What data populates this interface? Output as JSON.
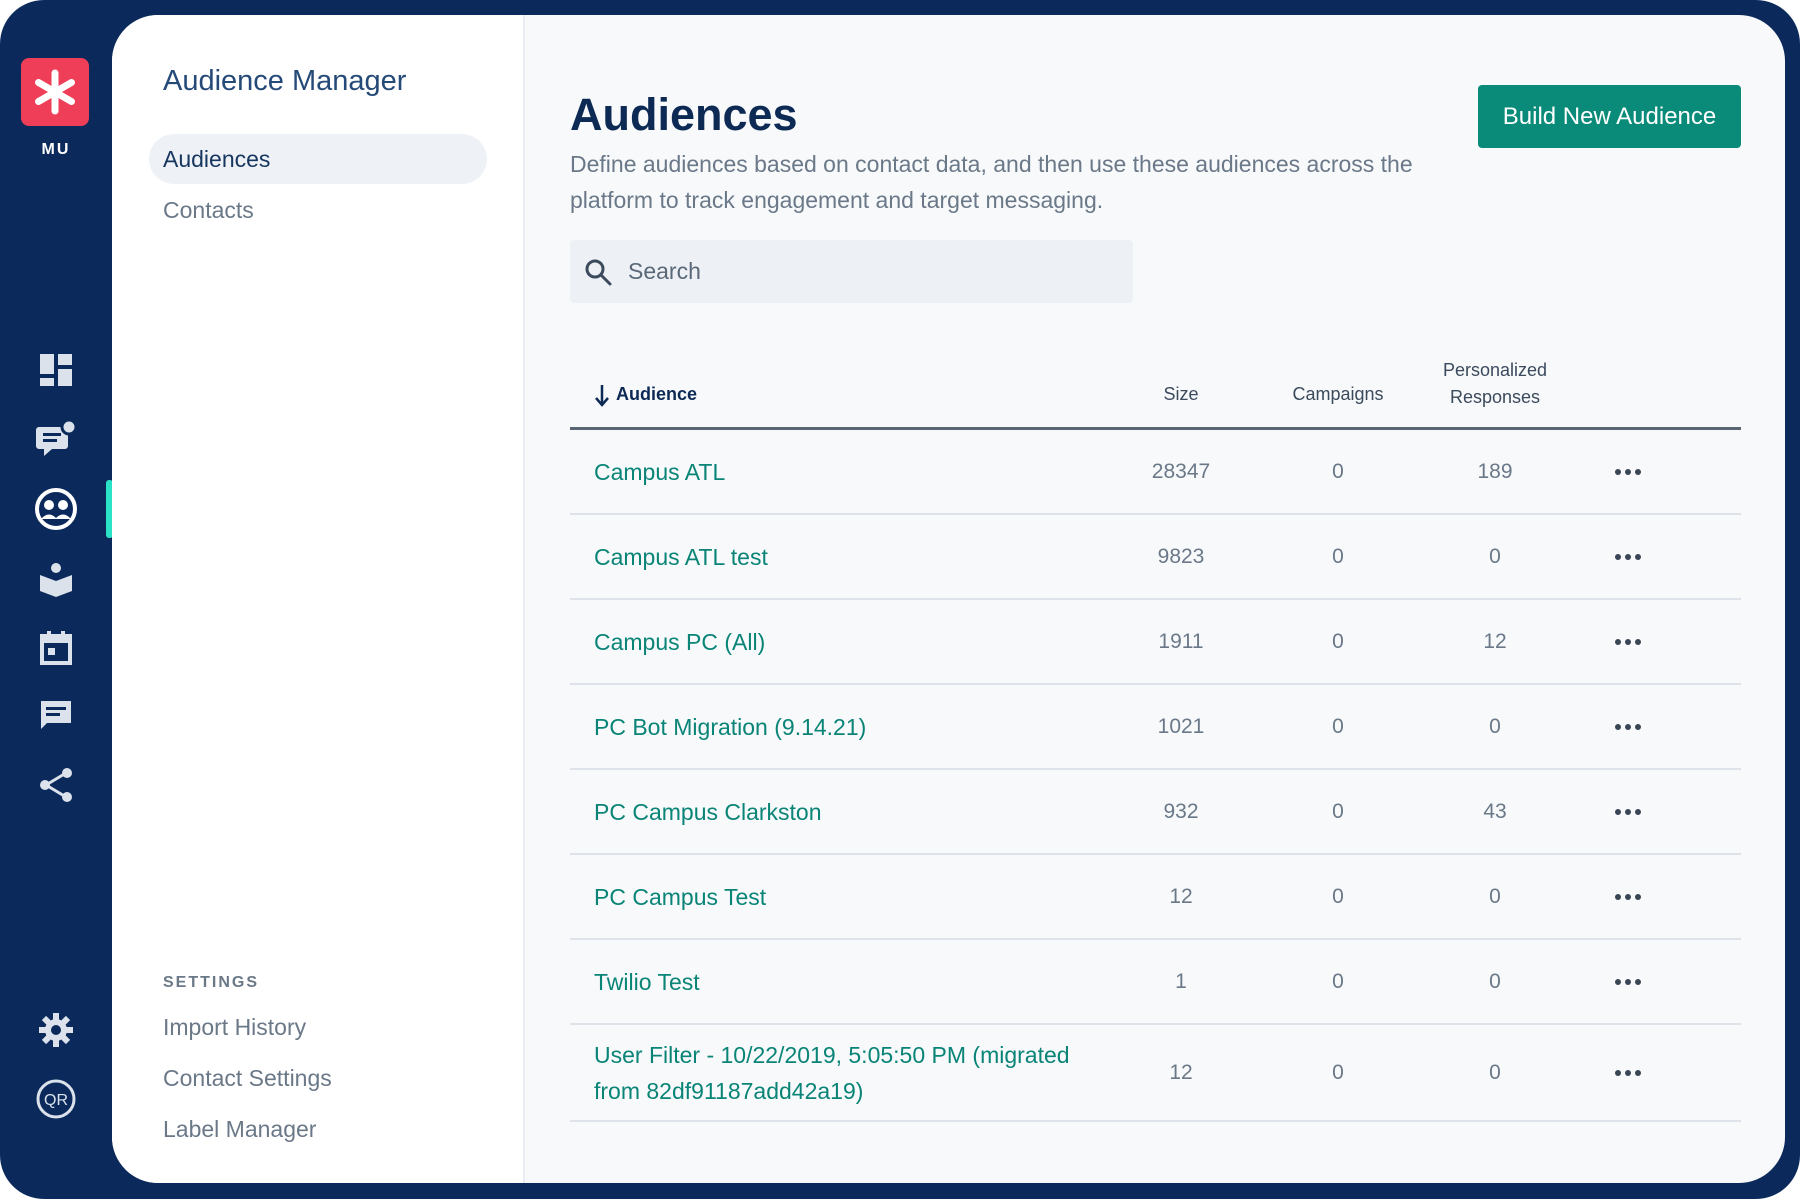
{
  "rail": {
    "logo_text": "MU",
    "accent": "#2ce2c6",
    "icons": [
      "dashboard-icon",
      "chat-bubbles-icon",
      "audience-icon",
      "book-icon",
      "calendar-icon",
      "message-icon",
      "share-icon",
      "gear-icon",
      "qr-icon"
    ]
  },
  "subnav": {
    "title": "Audience Manager",
    "items": [
      {
        "label": "Audiences",
        "active": true
      },
      {
        "label": "Contacts",
        "active": false
      }
    ],
    "settings_heading": "SETTINGS",
    "settings_items": [
      "Import History",
      "Contact Settings",
      "Label Manager"
    ]
  },
  "main": {
    "title": "Audiences",
    "description": "Define audiences based on contact data, and then use these audiences across the platform to track engagement and target messaging.",
    "build_button": "Build New Audience",
    "search_placeholder": "Search",
    "colors": {
      "primary": "#0a8a79",
      "link": "#0a8477",
      "navy": "#0b2a5b"
    }
  },
  "table": {
    "headers": {
      "audience": "Audience",
      "size": "Size",
      "campaigns": "Campaigns",
      "responses_line1": "Personalized",
      "responses_line2": "Responses"
    },
    "sort": "descending",
    "rows": [
      {
        "name": "Campus ATL",
        "size": "28347",
        "campaigns": "0",
        "responses": "189"
      },
      {
        "name": "Campus ATL test",
        "size": "9823",
        "campaigns": "0",
        "responses": "0"
      },
      {
        "name": "Campus PC (All)",
        "size": "1911",
        "campaigns": "0",
        "responses": "12"
      },
      {
        "name": "PC Bot Migration (9.14.21)",
        "size": "1021",
        "campaigns": "0",
        "responses": "0"
      },
      {
        "name": "PC Campus Clarkston",
        "size": "932",
        "campaigns": "0",
        "responses": "43"
      },
      {
        "name": "PC Campus Test",
        "size": "12",
        "campaigns": "0",
        "responses": "0"
      },
      {
        "name": "Twilio Test",
        "size": "1",
        "campaigns": "0",
        "responses": "0"
      },
      {
        "name": "User Filter - 10/22/2019, 5:05:50 PM (migrated from 82df91187add42a19)",
        "size": "12",
        "campaigns": "0",
        "responses": "0"
      }
    ]
  }
}
